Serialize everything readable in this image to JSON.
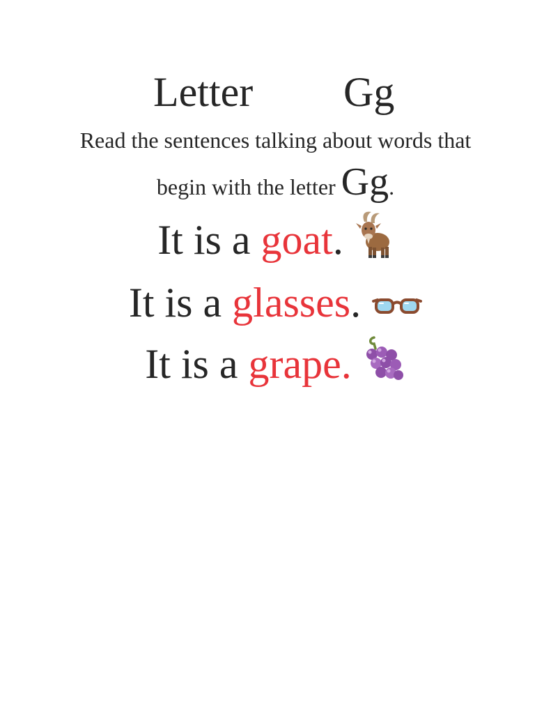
{
  "title": {
    "word": "Letter",
    "letter": "Gg"
  },
  "instruction": {
    "line1": "Read the sentences talking about words that",
    "line2_text": "begin with the letter ",
    "line2_letter": "Gg",
    "line2_end": "."
  },
  "sentences": [
    {
      "prefix": "It is a ",
      "word": "goat",
      "end": ".",
      "icon": "goat-icon"
    },
    {
      "prefix": "It is a ",
      "word": "glasses",
      "end": ".",
      "icon": "glasses-icon"
    },
    {
      "prefix": "It is a ",
      "word": "grape.",
      "end": "",
      "icon": "grapes-icon"
    }
  ],
  "colors": {
    "text": "#262626",
    "keyword": "#e8343a"
  }
}
